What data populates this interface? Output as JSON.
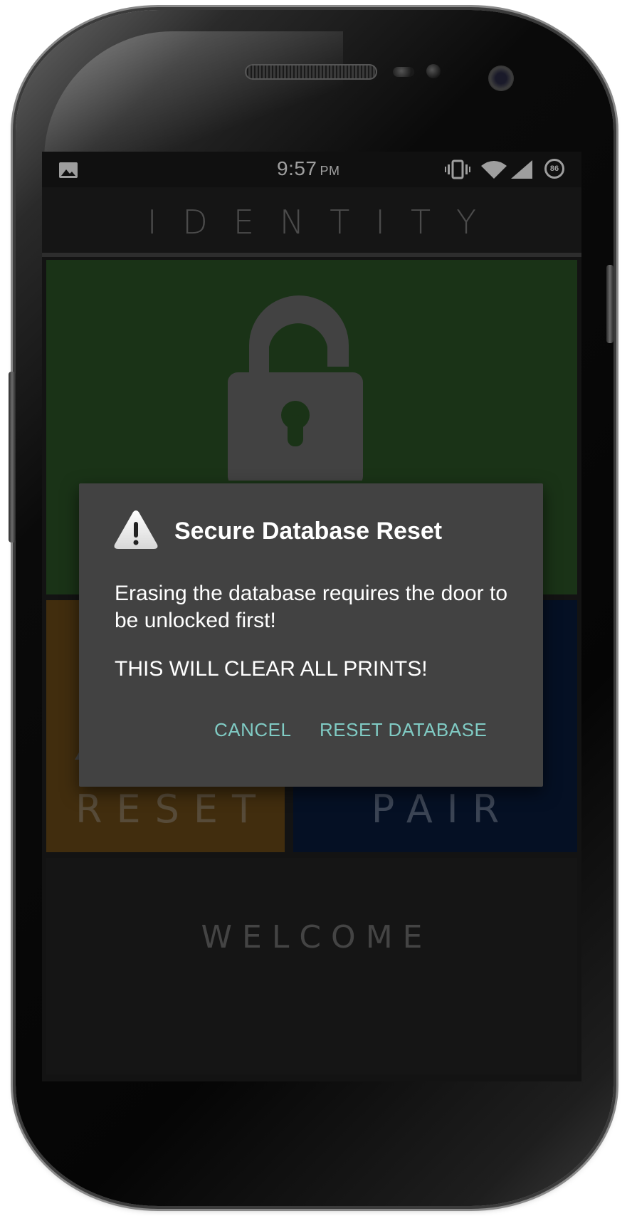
{
  "status_bar": {
    "time": "9:57",
    "ampm": "PM",
    "battery_level": "86",
    "icons": [
      "image-icon",
      "vibrate-icon",
      "wifi-icon",
      "signal-icon",
      "battery-icon"
    ]
  },
  "app": {
    "title": "IDENTITY"
  },
  "tiles": {
    "unlock": {
      "icon": "unlock-padlock-icon",
      "color": "#2b5326"
    },
    "reset": {
      "label": "RESET",
      "color": "#6a4a17"
    },
    "pair": {
      "label": "PAIR",
      "color": "#091a3a"
    },
    "welcome": {
      "label": "WELCOME",
      "color": "#232323"
    }
  },
  "dialog": {
    "icon": "warning-triangle-icon",
    "title": "Secure Database Reset",
    "message": "Erasing the database requires the door to be unlocked first!",
    "warning": "THIS WILL CLEAR ALL PRINTS!",
    "cancel_label": "CANCEL",
    "confirm_label": "RESET DATABASE",
    "button_color": "#80cbc4",
    "background": "#424242"
  }
}
